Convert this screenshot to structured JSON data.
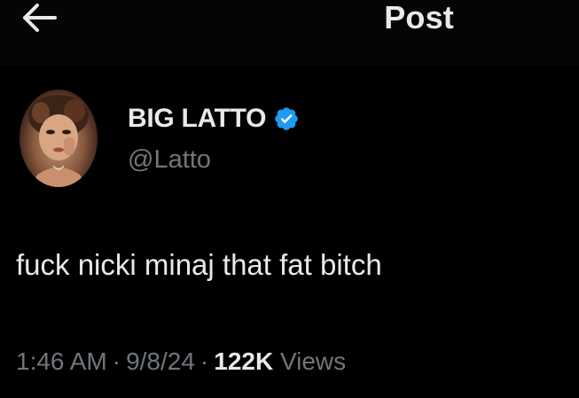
{
  "header": {
    "back_icon": "arrow-left-icon",
    "title": "Post"
  },
  "post": {
    "author": {
      "display_name": "BIG LATTO",
      "handle": "@Latto",
      "verified": true,
      "verified_icon": "verified-badge-icon",
      "verified_color": "#1d9bf0"
    },
    "text": "fuck nicki minaj that fat bitch",
    "time": "1:46 AM",
    "separator": "·",
    "date": "9/8/24",
    "views_count": "122K",
    "views_label": "Views"
  },
  "colors": {
    "background": "#000000",
    "primary_text": "#e7e9ea",
    "secondary_text": "#71767b",
    "accent": "#1d9bf0"
  }
}
